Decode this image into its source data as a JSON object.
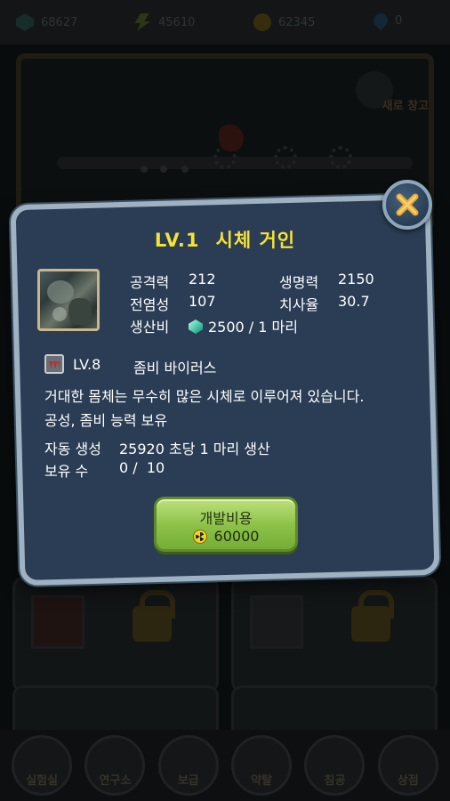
{
  "resources": {
    "gems": "68627",
    "energy": "45610",
    "radiation": "62345",
    "drops": "0"
  },
  "scene": {
    "new_storage_label": "새로 창고"
  },
  "modal": {
    "level": "LV.1",
    "name": "시체 거인",
    "stats": {
      "attack_label": "공격력",
      "attack_value": "212",
      "hp_label": "생명력",
      "hp_value": "2150",
      "infect_label": "전염성",
      "infect_value": "107",
      "fatality_label": "치사율",
      "fatality_value": "30.7",
      "cost_label": "생산비",
      "cost_value": "2500 / 1 마리"
    },
    "requirement": {
      "level": "LV.8",
      "name": "좀비 바이러스"
    },
    "description": [
      "거대한 몸체는 무수히 많은 시체로 이루어져 있습니다.",
      "공성, 좀비 능력 보유"
    ],
    "auto_gen": {
      "label": "자동 생성",
      "value": "25920 초당 1 마리 생산"
    },
    "owned": {
      "label": "보유 수",
      "value": "0 /  10"
    },
    "dev_button": {
      "label": "개발비용",
      "cost": "60000"
    }
  },
  "bottom_nav": [
    "실험실",
    "연구소",
    "보급",
    "약탈",
    "침공",
    "상점"
  ]
}
